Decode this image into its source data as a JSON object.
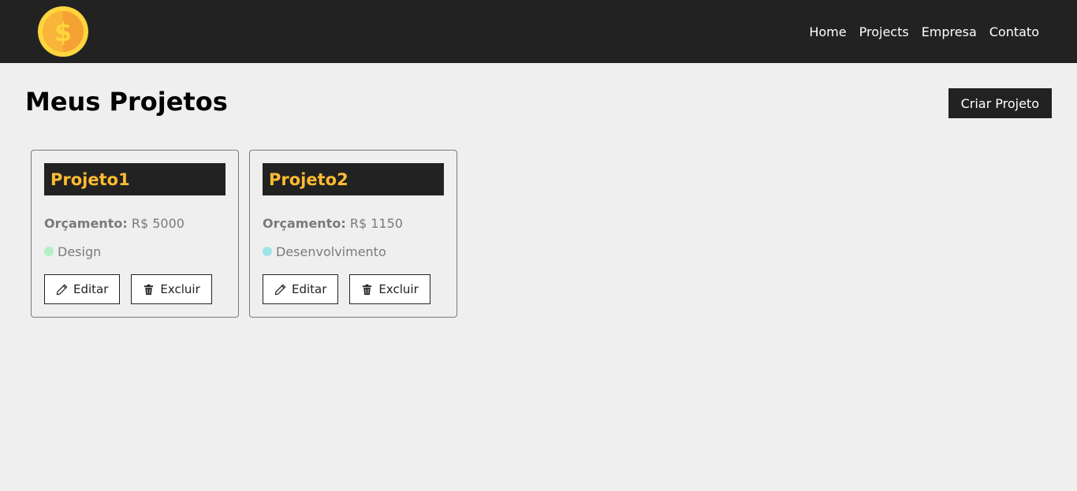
{
  "nav": {
    "logo_icon": "dollar-coin-icon",
    "links": [
      "Home",
      "Projects",
      "Empresa",
      "Contato"
    ]
  },
  "page": {
    "title": "Meus Projetos",
    "create_label": "Criar Projeto"
  },
  "projects": [
    {
      "name": "Projeto1",
      "budget_label": "Orçamento:",
      "budget_value": "R$ 5000",
      "category": "Design",
      "category_color": "#b2f0c4",
      "edit_label": "Editar",
      "delete_label": "Excluir"
    },
    {
      "name": "Projeto2",
      "budget_label": "Orçamento:",
      "budget_value": "R$ 1150",
      "category": "Desenvolvimento",
      "category_color": "#9fe5e8",
      "edit_label": "Editar",
      "delete_label": "Excluir"
    }
  ],
  "colors": {
    "navbar_bg": "#222222",
    "accent": "#ffbb33",
    "page_bg": "#efefef"
  }
}
